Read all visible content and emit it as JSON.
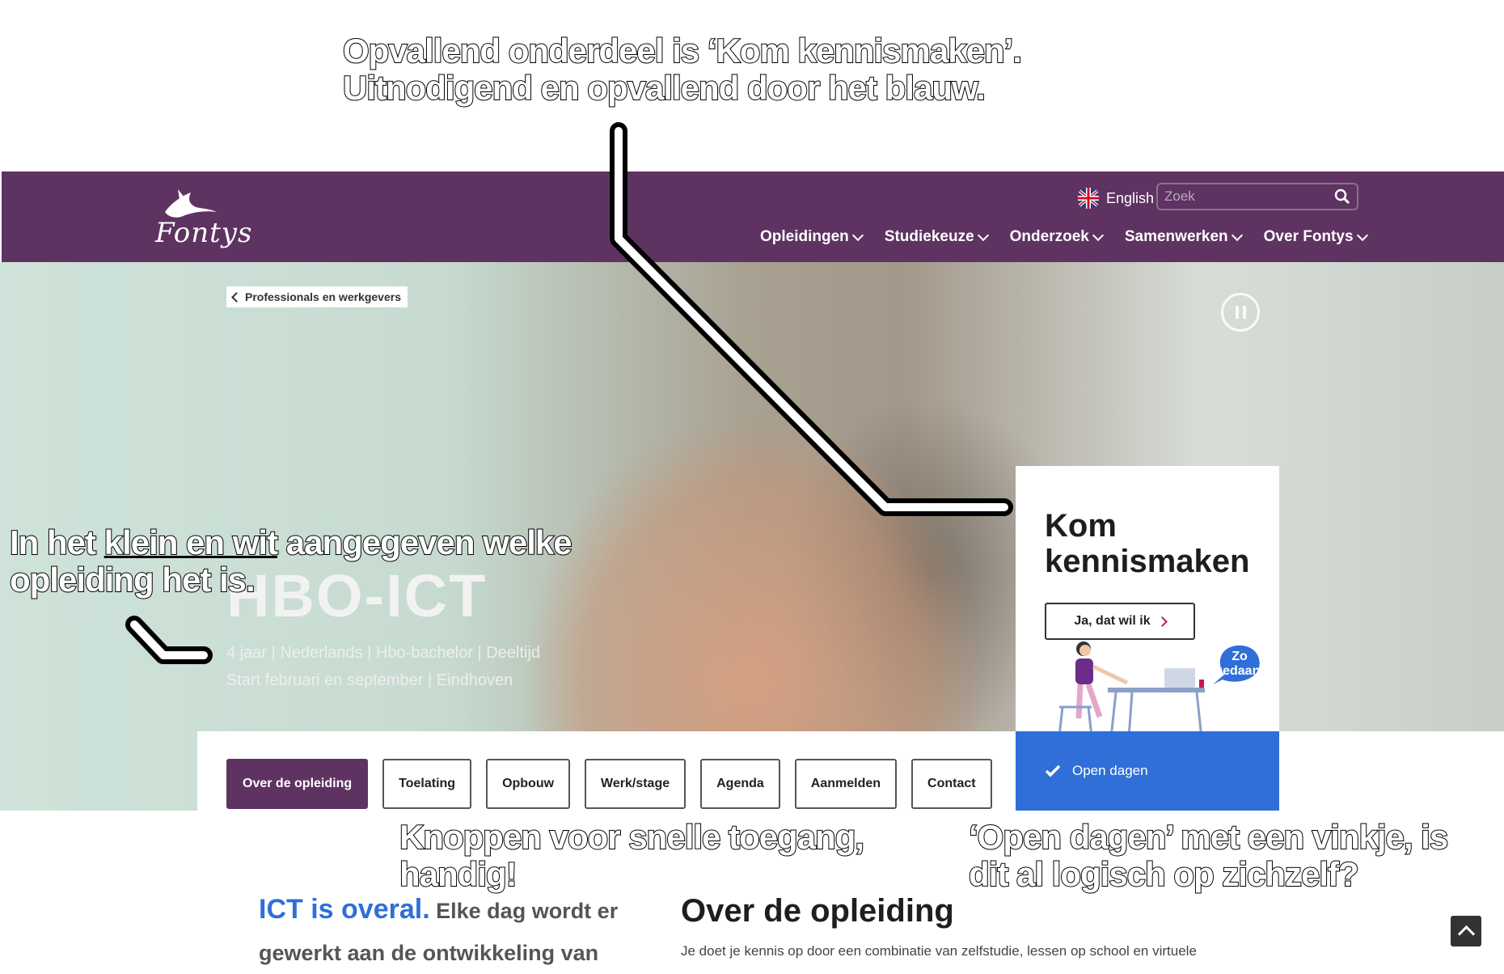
{
  "annotations": {
    "top_line1": "Opvallend onderdeel is ‘Kom kennismaken’.",
    "top_line2": "Uitnodigend en opvallend door het blauw.",
    "left_pre": "In het ",
    "left_underlined": "klein en wit",
    "left_post": " aangegeven  welke",
    "left_line2": "opleiding het is.",
    "tabs_line1": "Knoppen voor snelle toegang,",
    "tabs_line2": "handig!",
    "open_line1": "‘Open dagen’ met een vinkje, is",
    "open_line2": "dit al logisch op zichzelf?"
  },
  "header": {
    "logo_text": "Fontys",
    "language": "English",
    "search_placeholder": "Zoek",
    "nav": [
      "Opleidingen",
      "Studiekeuze",
      "Onderzoek",
      "Samenwerken",
      "Over Fontys"
    ]
  },
  "hero": {
    "breadcrumb": "Professionals en werkgevers",
    "title": "HBO-ICT",
    "meta_line1": "4 jaar | Nederlands | Hbo-bachelor | Deeltijd",
    "meta_line2": "Start februari en september | Eindhoven"
  },
  "card": {
    "title": "Kom kennismaken",
    "button": "Ja, dat wil ik",
    "bubble_line1": "Zo",
    "bubble_line2": "gedaan!",
    "open_days": "Open dagen"
  },
  "tabs": [
    "Over de opleiding",
    "Toelating",
    "Opbouw",
    "Werk/stage",
    "Agenda",
    "Aanmelden",
    "Contact"
  ],
  "content": {
    "ict_highlight": "ICT is overal.",
    "ict_rest": " Elke dag wordt er gewerkt aan de ontwikkeling van",
    "over_title": "Over de opleiding",
    "over_text": "Je doet je kennis op door een combinatie van zelfstudie, lessen op school en virtuele"
  },
  "colors": {
    "brand_purple": "#5e3361",
    "accent_blue": "#2f6fd7",
    "accent_pink": "#c2185b"
  }
}
